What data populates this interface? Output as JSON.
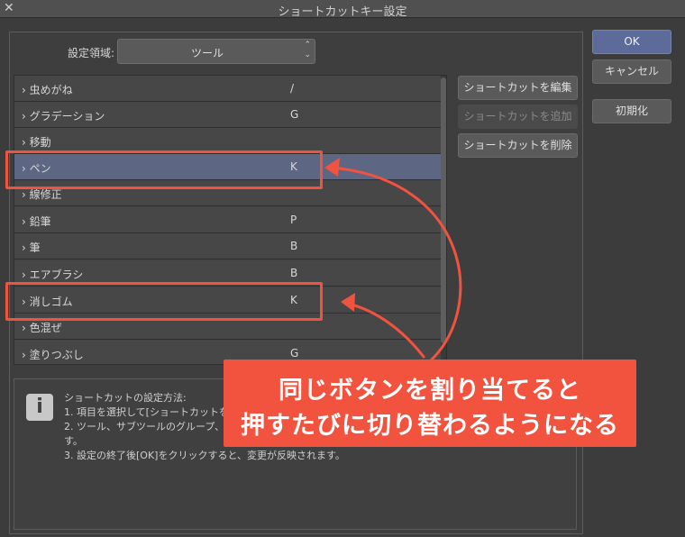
{
  "window": {
    "title": "ショートカットキー設定",
    "close_glyph": "✕"
  },
  "settings_area": {
    "label": "設定領域:",
    "value": "ツール"
  },
  "list": [
    {
      "name": "虫めがね",
      "key": "/",
      "selected": false
    },
    {
      "name": "グラデーション",
      "key": "G",
      "selected": false
    },
    {
      "name": "移動",
      "key": "",
      "selected": false
    },
    {
      "name": "ペン",
      "key": "K",
      "selected": true
    },
    {
      "name": "線修正",
      "key": "",
      "selected": false
    },
    {
      "name": "鉛筆",
      "key": "P",
      "selected": false
    },
    {
      "name": "筆",
      "key": "B",
      "selected": false
    },
    {
      "name": "エアブラシ",
      "key": "B",
      "selected": false
    },
    {
      "name": "消しゴム",
      "key": "K",
      "selected": false
    },
    {
      "name": "色混ぜ",
      "key": "",
      "selected": false
    },
    {
      "name": "塗りつぶし",
      "key": "G",
      "selected": false
    }
  ],
  "side_buttons": {
    "edit": "ショートカットを編集",
    "add": "ショートカットを追加",
    "delete": "ショートカットを削除"
  },
  "dialog_buttons": {
    "ok": "OK",
    "cancel": "キャンセル",
    "initialize": "初期化"
  },
  "info": {
    "icon": "info-icon",
    "lines": [
      "ショートカットの設定方法:",
      "1. 項目を選択して[ショートカットを",
      "2. ツール、サブツールのグループ、",
      "す。",
      "3. 設定の終了後[OK]をクリックすると、変更が反映されます。"
    ]
  },
  "annotation": {
    "line1": "同じボタンを割り当てると",
    "line2": "押すたびに切り替わるようになる",
    "color": "#f2533e"
  },
  "colors": {
    "background": "#3c3c3c",
    "selected_row": "#5d6682",
    "ok_button": "#5d6b9a",
    "highlight": "#f2533e"
  }
}
